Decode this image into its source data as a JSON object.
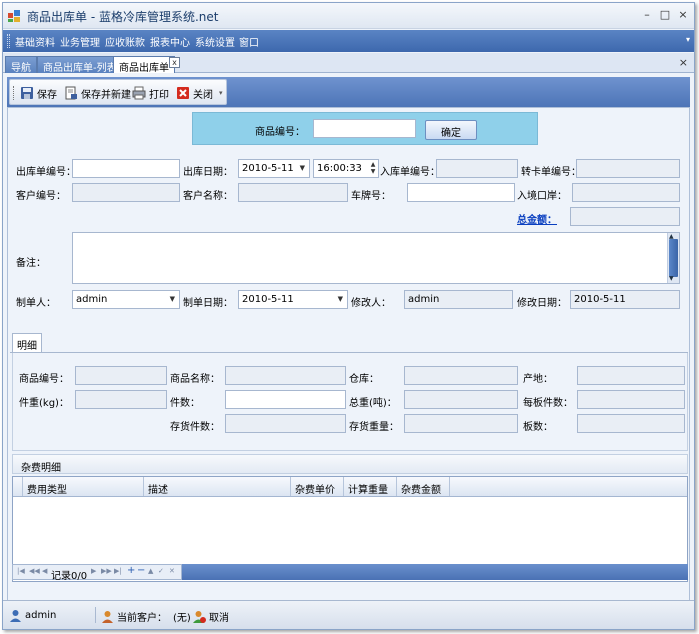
{
  "window": {
    "title": "商品出库单 - 蓝格冷库管理系统.net",
    "minimize": "–",
    "maximize": "□",
    "close": "×"
  },
  "menu": {
    "items": [
      "基础资料",
      "业务管理",
      "应收账款",
      "报表中心",
      "系统设置",
      "窗口"
    ],
    "dropdown": "▾"
  },
  "tabs": {
    "items": [
      "导航",
      "商品出库单-列表",
      "商品出库单"
    ],
    "close_glyph": "x",
    "strip_close": "×"
  },
  "toolbar": {
    "save": "保存",
    "save_new": "保存并新建",
    "print": "打印",
    "close": "关闭",
    "dropdown": "▾"
  },
  "scan": {
    "label": "商品编号：",
    "value": "",
    "confirm": "确定"
  },
  "form": {
    "out_no_label": "出库单编号：",
    "out_no": "",
    "out_date_label": "出库日期：",
    "out_date": "2010-5-11",
    "out_time": "16:00:33",
    "in_no_label": "入库单编号：",
    "in_no": "",
    "transfer_no_label": "转卡单编号：",
    "transfer_no": "",
    "customer_no_label": "客户编号：",
    "customer_no": "",
    "customer_name_label": "客户名称：",
    "customer_name": "",
    "plate_label": "车牌号：",
    "plate": "",
    "port_label": "入境口岸：",
    "port": "",
    "total_label": "总金额：",
    "total": "",
    "remark_label": "备注：",
    "remark": "",
    "maker_label": "制单人：",
    "maker": "admin",
    "make_date_label": "制单日期：",
    "make_date": "2010-5-11",
    "modifier_label": "修改人：",
    "modifier": "admin",
    "modify_date_label": "修改日期：",
    "modify_date": "2010-5-11"
  },
  "detail": {
    "tab": "明细",
    "product_no_label": "商品编号：",
    "product_no": "",
    "product_name_label": "商品名称：",
    "product_name": "",
    "warehouse_label": "仓库：",
    "warehouse": "",
    "origin_label": "产地：",
    "origin": "",
    "unit_weight_label": "件重(kg)：",
    "unit_weight": "",
    "pieces_label": "件数：",
    "pieces": "",
    "total_weight_label": "总重(吨)：",
    "total_weight": "",
    "per_board_label": "每板件数：",
    "per_board": "",
    "stock_pieces_label": "存货件数：",
    "stock_pieces": "",
    "stock_weight_label": "存货重量：",
    "stock_weight": "",
    "boards_label": "板数：",
    "boards": ""
  },
  "misc": {
    "header": "杂费明细",
    "columns": [
      "费用类型",
      "描述",
      "杂费单价",
      "计算重量",
      "杂费金额"
    ],
    "nav_record": "记录0/0"
  },
  "status": {
    "user": "admin",
    "customer_label": "当前客户：",
    "customer_value": "(无)",
    "cancel": "取消"
  }
}
